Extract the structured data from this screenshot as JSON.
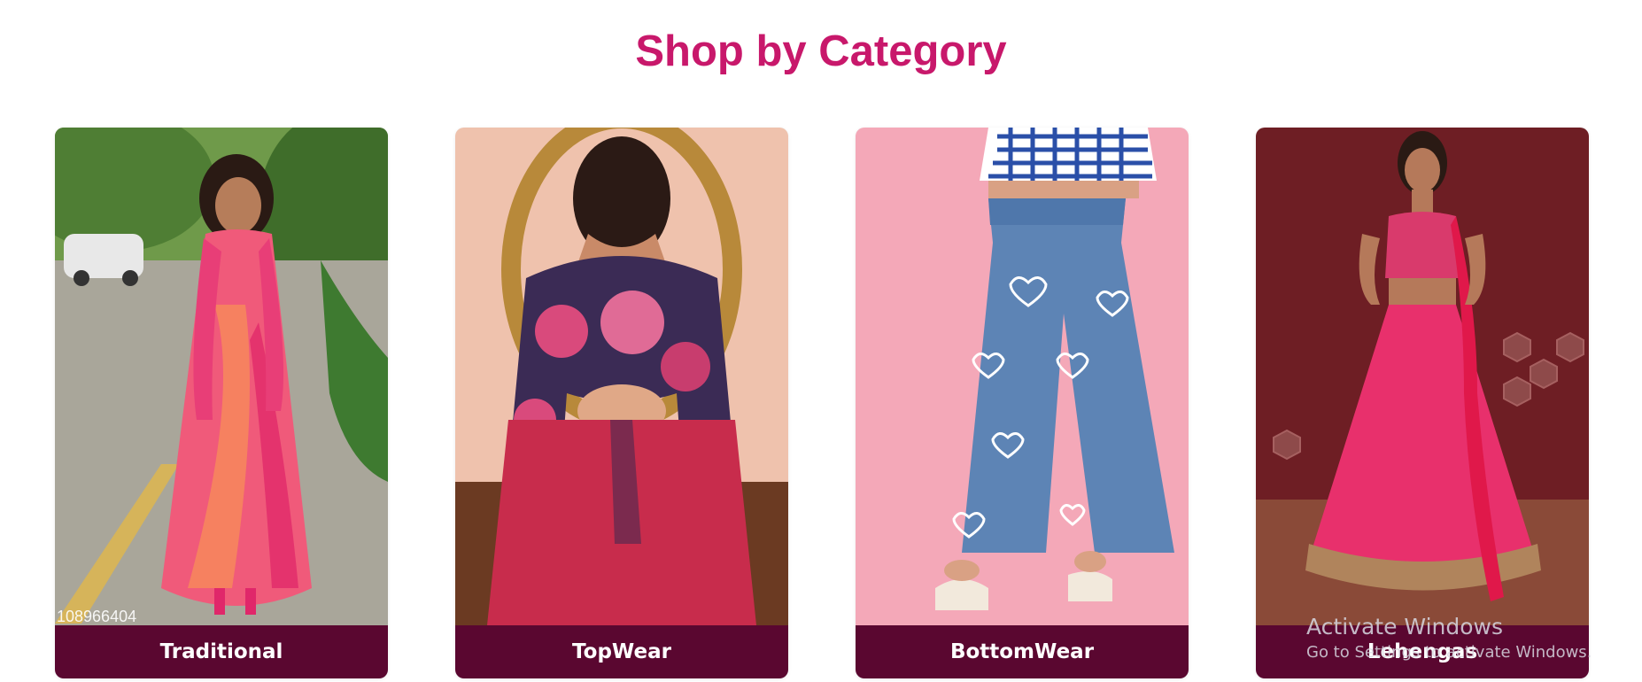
{
  "section": {
    "title": "Shop by Category"
  },
  "categories": [
    {
      "label": "Traditional",
      "image_id": "108966404"
    },
    {
      "label": "TopWear"
    },
    {
      "label": "BottomWear"
    },
    {
      "label": "Lehengas"
    }
  ],
  "watermark": {
    "title": "Activate Windows",
    "subtitle": "Go to Settings to activate Windows."
  },
  "colors": {
    "title": "#c8186b",
    "label_bg": "#5a0730",
    "label_text": "#ffffff"
  }
}
